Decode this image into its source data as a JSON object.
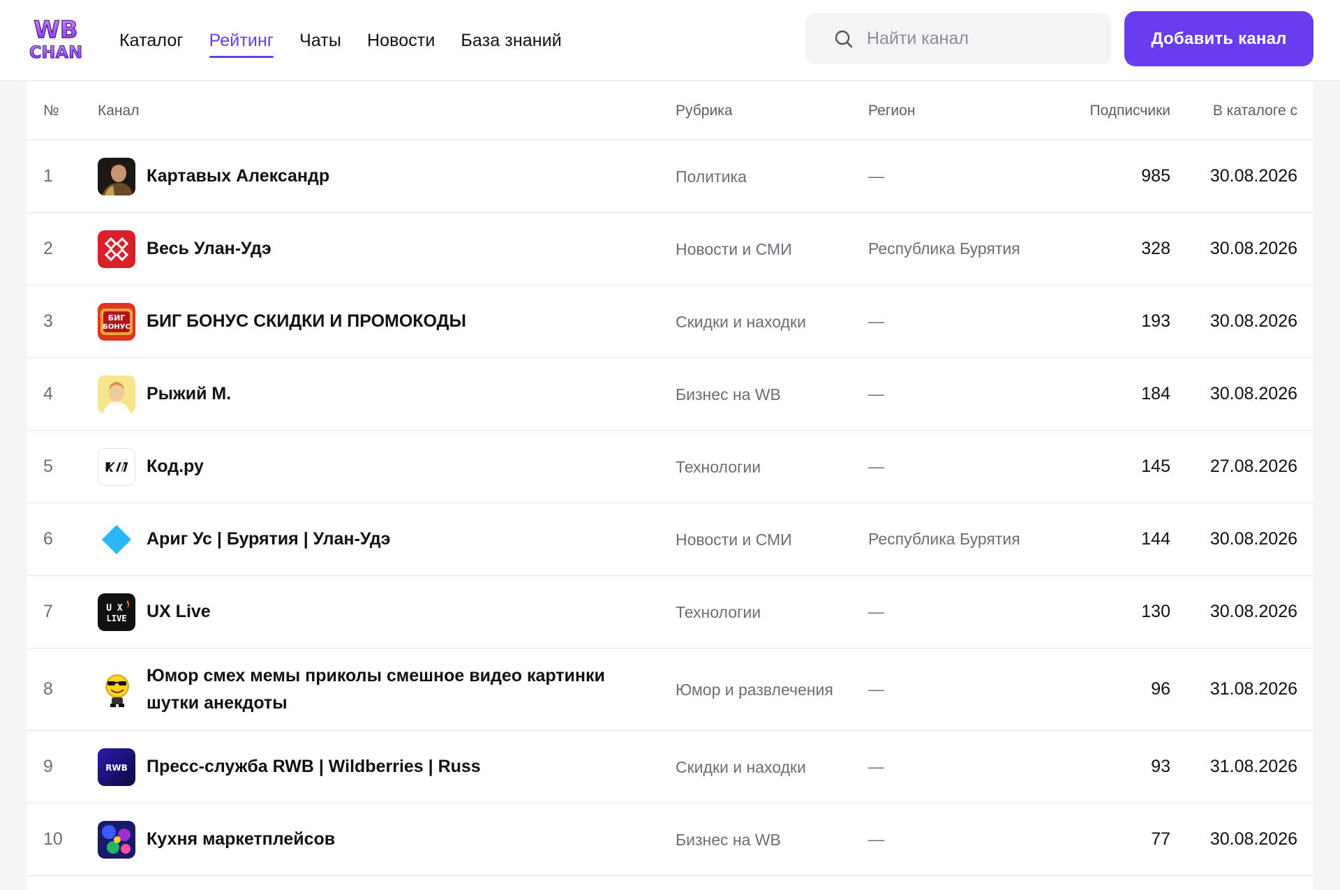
{
  "header": {
    "logo_text": "WB CHAN",
    "nav": [
      {
        "label": "Каталог",
        "active": false
      },
      {
        "label": "Рейтинг",
        "active": true
      },
      {
        "label": "Чаты",
        "active": false
      },
      {
        "label": "Новости",
        "active": false
      },
      {
        "label": "База знаний",
        "active": false
      }
    ],
    "search": {
      "placeholder": "Найти канал",
      "value": ""
    },
    "add_button_label": "Добавить канал"
  },
  "table": {
    "columns": {
      "num": "№",
      "channel": "Канал",
      "rubric": "Рубрика",
      "region": "Регион",
      "subscribers": "Подписчики",
      "added": "В каталоге с"
    },
    "rows": [
      {
        "num": "1",
        "name": "Картавых Александр",
        "rubric": "Политика",
        "region": "—",
        "subscribers": "985",
        "added": "30.08.2026",
        "avatar_icon": "portrait-avatar-icon"
      },
      {
        "num": "2",
        "name": "Весь Улан-Удэ",
        "rubric": "Новости и СМИ",
        "region": "Республика Бурятия",
        "subscribers": "328",
        "added": "30.08.2026",
        "avatar_icon": "ornament-avatar-icon"
      },
      {
        "num": "3",
        "name": "БИГ БОНУС СКИДКИ И ПРОМОКОДЫ",
        "rubric": "Скидки и находки",
        "region": "—",
        "subscribers": "193",
        "added": "30.08.2026",
        "avatar_icon": "big-bonus-avatar-icon",
        "avatar_text": "БИГ БОНУС"
      },
      {
        "num": "4",
        "name": "Рыжий М.",
        "rubric": "Бизнес на WB",
        "region": "—",
        "subscribers": "184",
        "added": "30.08.2026",
        "avatar_icon": "person-avatar-icon"
      },
      {
        "num": "5",
        "name": "Код.ру",
        "rubric": "Технологии",
        "region": "—",
        "subscribers": "145",
        "added": "27.08.2026",
        "avatar_icon": "kod-logo-avatar-icon"
      },
      {
        "num": "6",
        "name": "Ариг Ус | Бурятия | Улан-Удэ",
        "rubric": "Новости и СМИ",
        "region": "Республика Бурятия",
        "subscribers": "144",
        "added": "30.08.2026",
        "avatar_icon": "diamond-avatar-icon"
      },
      {
        "num": "7",
        "name": "UX Live",
        "rubric": "Технологии",
        "region": "—",
        "subscribers": "130",
        "added": "30.08.2026",
        "avatar_icon": "ux-live-avatar-icon",
        "avatar_text": "UX LIVE"
      },
      {
        "num": "8",
        "name": "Юмор смех мемы приколы смешное видео картинки шутки анекдоты",
        "rubric": "Юмор и развлечения",
        "region": "—",
        "subscribers": "96",
        "added": "31.08.2026",
        "avatar_icon": "smiley-sunglasses-avatar-icon"
      },
      {
        "num": "9",
        "name": "Пресс-служба RWB | Wildberries | Russ",
        "rubric": "Скидки и находки",
        "region": "—",
        "subscribers": "93",
        "added": "31.08.2026",
        "avatar_icon": "rwb-logo-avatar-icon",
        "avatar_text": "RWB"
      },
      {
        "num": "10",
        "name": "Кухня маркетплейсов",
        "rubric": "Бизнес на WB",
        "region": "—",
        "subscribers": "77",
        "added": "30.08.2026",
        "avatar_icon": "space-collage-avatar-icon"
      }
    ]
  },
  "colors": {
    "accent": "#6a3cf0",
    "text": "#111111",
    "muted": "#6b6e76"
  }
}
